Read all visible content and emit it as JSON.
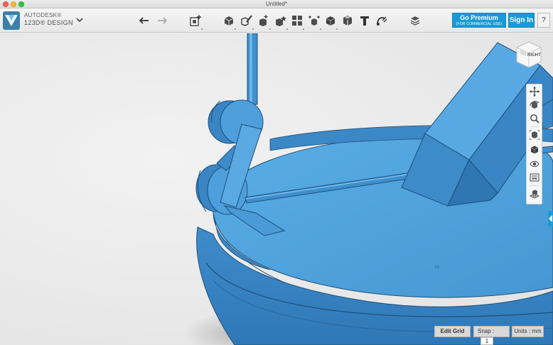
{
  "window": {
    "title": "Untitled*"
  },
  "brand": {
    "line1": "AUTODESK®",
    "line2": "123D® DESIGN"
  },
  "toolbar": {
    "tools": [
      {
        "name": "undo-icon"
      },
      {
        "name": "redo-icon"
      },
      {
        "name": "import-icon"
      },
      {
        "name": "primitives-icon"
      },
      {
        "name": "sketch-icon"
      },
      {
        "name": "construct-icon"
      },
      {
        "name": "modify-icon"
      },
      {
        "name": "pattern-icon"
      },
      {
        "name": "group-icon"
      },
      {
        "name": "combine-icon"
      },
      {
        "name": "measure-icon"
      },
      {
        "name": "text-icon"
      },
      {
        "name": "snap-icon"
      },
      {
        "name": "materials-icon"
      }
    ]
  },
  "account": {
    "premium_label": "Go Premium",
    "premium_sub": "(FOR COMMERCIAL USE)",
    "signin_label": "Sign In",
    "help_label": "?"
  },
  "viewcube": {
    "face": "RIGHT"
  },
  "navbar": {
    "items": [
      "pan-icon",
      "orbit-icon",
      "zoom-icon",
      "fit-icon",
      "perspective-icon",
      "visibility-icon",
      "materials-outlines-icon",
      "grid-icon"
    ]
  },
  "status": {
    "edit_grid": "Edit Grid",
    "snap_label": "Snap :",
    "snap_value": "1",
    "units": "Units : mm"
  },
  "colors": {
    "accent": "#1a9bd7",
    "model": "#4a9fdc",
    "model_dark": "#2f6f9e",
    "model_light": "#6cb6e8"
  }
}
